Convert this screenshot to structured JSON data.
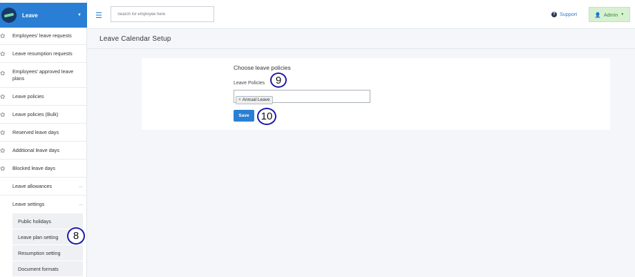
{
  "sidebar": {
    "module_title": "Leave",
    "items": [
      {
        "label": "Employees' leave requests",
        "icon": "gear-icon"
      },
      {
        "label": "Leave resumption requests",
        "icon": "gear-icon"
      },
      {
        "label": "Employees' approved leave plans",
        "icon": "gear-icon"
      },
      {
        "label": "Leave policies",
        "icon": "gear-icon"
      },
      {
        "label": "Leave policies (Bulk)",
        "icon": "gear-icon"
      },
      {
        "label": "Reserved leave days",
        "icon": "gear-icon"
      },
      {
        "label": "Additional leave days",
        "icon": "gear-icon"
      },
      {
        "label": "Blocked leave days",
        "icon": "gear-icon"
      },
      {
        "label": "Leave allowances",
        "icon": ""
      },
      {
        "label": "Leave settings",
        "icon": ""
      }
    ],
    "sub_items": [
      {
        "label": "Public holidays"
      },
      {
        "label": "Leave plan setting"
      },
      {
        "label": "Resumption setting"
      },
      {
        "label": "Document formats"
      }
    ],
    "more_glyph": "..."
  },
  "topbar": {
    "search_placeholder": "Search for employee here",
    "support_label": "Support",
    "user_label": "Admin"
  },
  "main": {
    "page_title": "Leave Calendar Setup",
    "section_label": "Choose leave policies",
    "field_label": "Leave Policies",
    "selected_policy": "Annual Leave",
    "save_label": "Save"
  },
  "markers": {
    "m8": "8",
    "m9": "9",
    "m10": "10"
  },
  "colors": {
    "accent": "#2a7fd4",
    "admin_bg": "#d8f0d2",
    "admin_text": "#2f8a2f",
    "marker_ring": "#1a1aa6"
  }
}
